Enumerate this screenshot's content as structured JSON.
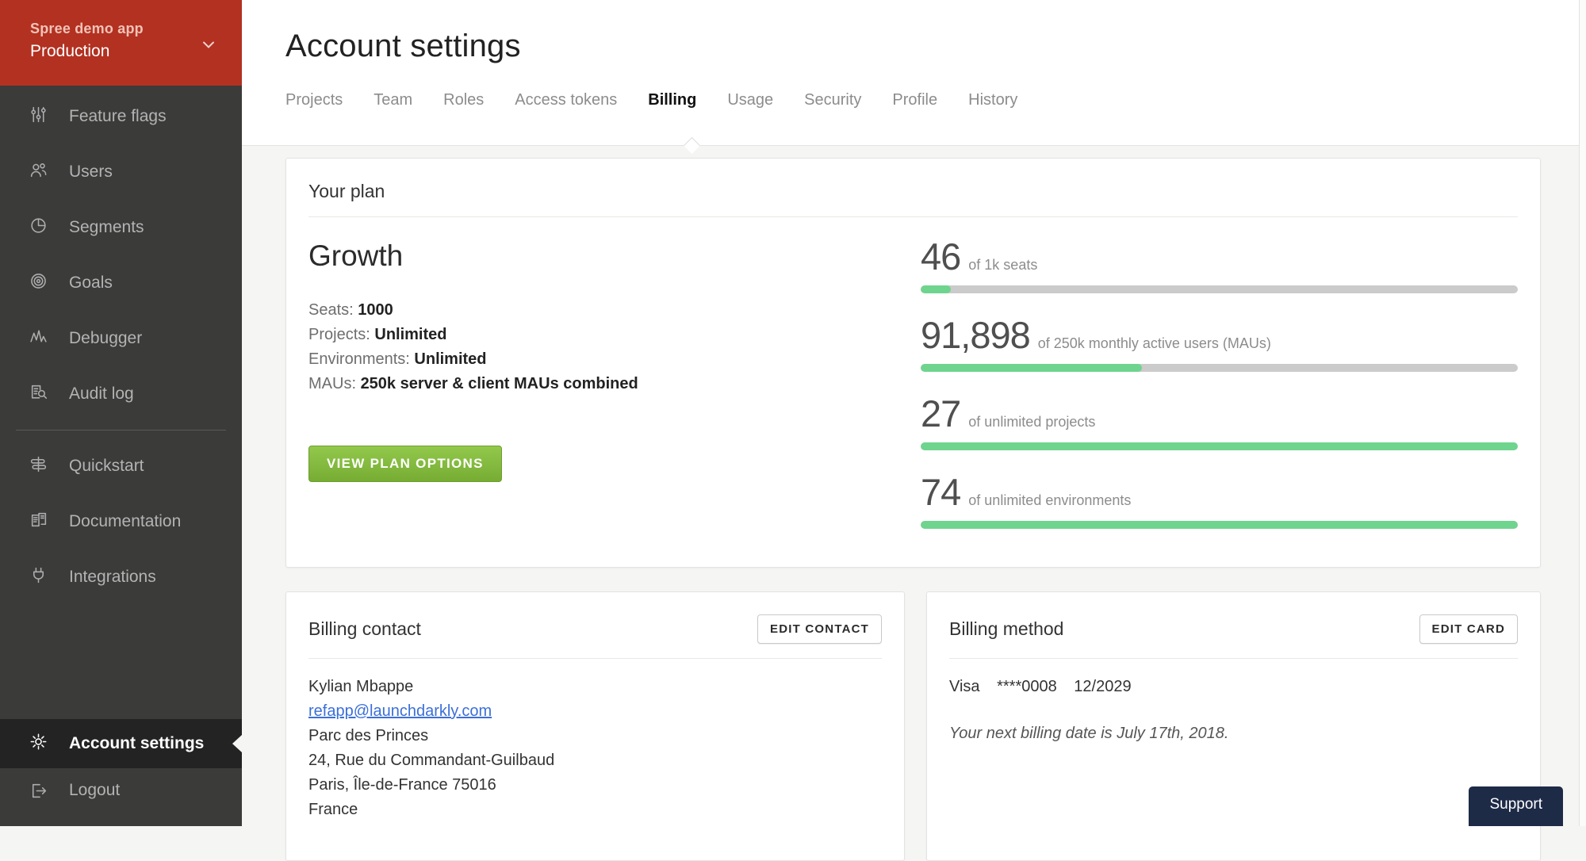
{
  "sidebar": {
    "env_switcher": {
      "app_name": "Spree demo app",
      "env_name": "Production",
      "chevron_icon": "chevron-down-icon"
    },
    "items": [
      {
        "label": "Feature flags",
        "icon": "sliders-icon"
      },
      {
        "label": "Users",
        "icon": "users-icon"
      },
      {
        "label": "Segments",
        "icon": "pie-chart-icon"
      },
      {
        "label": "Goals",
        "icon": "target-icon"
      },
      {
        "label": "Debugger",
        "icon": "waveform-icon"
      },
      {
        "label": "Audit log",
        "icon": "document-magnifier-icon"
      },
      {
        "label": "Quickstart",
        "icon": "signpost-icon"
      },
      {
        "label": "Documentation",
        "icon": "book-icon"
      },
      {
        "label": "Integrations",
        "icon": "plug-icon"
      }
    ],
    "footer_items": [
      {
        "label": "Account settings",
        "icon": "gear-icon",
        "active": true
      },
      {
        "label": "Logout",
        "icon": "logout-icon",
        "active": false
      }
    ]
  },
  "header": {
    "title": "Account settings",
    "tabs": [
      {
        "label": "Projects"
      },
      {
        "label": "Team"
      },
      {
        "label": "Roles"
      },
      {
        "label": "Access tokens"
      },
      {
        "label": "Billing"
      },
      {
        "label": "Usage"
      },
      {
        "label": "Security"
      },
      {
        "label": "Profile"
      },
      {
        "label": "History"
      }
    ],
    "active_tab": "Billing"
  },
  "plan_card": {
    "section_title": "Your plan",
    "plan_name": "Growth",
    "details": [
      {
        "label": "Seats:",
        "value": "1000"
      },
      {
        "label": "Projects:",
        "value": "Unlimited"
      },
      {
        "label": "Environments:",
        "value": "Unlimited"
      },
      {
        "label": "MAUs:",
        "value": "250k server & client MAUs combined"
      }
    ],
    "cta_label": "VIEW PLAN OPTIONS",
    "stats": [
      {
        "value": "46",
        "caption": "of 1k seats",
        "percent": 5
      },
      {
        "value": "91,898",
        "caption": "of 250k monthly active users (MAUs)",
        "percent": 37
      },
      {
        "value": "27",
        "caption": "of unlimited projects",
        "percent": 100
      },
      {
        "value": "74",
        "caption": "of unlimited environments",
        "percent": 100
      }
    ]
  },
  "billing_contact": {
    "title": "Billing contact",
    "edit_label": "EDIT CONTACT",
    "name": "Kylian Mbappe",
    "email": "refapp@launchdarkly.com",
    "address_lines": [
      "Parc des Princes",
      "24, Rue du Commandant-Guilbaud",
      "Paris, Île-de-France 75016",
      "France"
    ]
  },
  "billing_method": {
    "title": "Billing method",
    "edit_label": "EDIT CARD",
    "card_brand": "Visa",
    "card_number": "****0008",
    "card_expiry": "12/2029",
    "next_billing_note": "Your next billing date is July 17th, 2018."
  },
  "support": {
    "label": "Support"
  },
  "colors": {
    "sidebar_bg": "#3b3b3a",
    "sidebar_active_bg": "#232323",
    "env_header_red": "#b23121",
    "cta_green": "#84bb40",
    "progress_green": "#6fd48e",
    "progress_track": "#cbcbcb",
    "link_blue": "#3b6fd9",
    "support_navy": "#1e2b47",
    "content_bg": "#f5f5f4"
  }
}
